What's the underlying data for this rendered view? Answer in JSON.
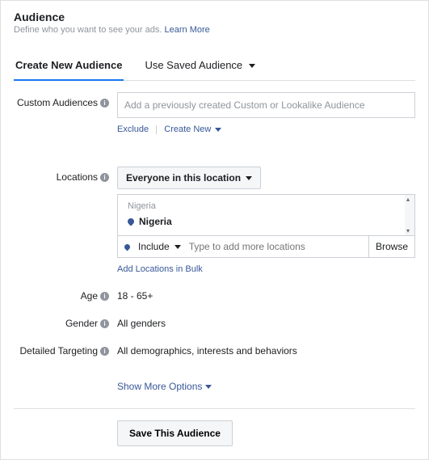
{
  "header": {
    "title": "Audience",
    "subtitle": "Define who you want to see your ads.",
    "learn_more": "Learn More"
  },
  "tabs": {
    "create": "Create New Audience",
    "saved": "Use Saved Audience"
  },
  "labels": {
    "custom": "Custom Audiences",
    "locations": "Locations",
    "age": "Age",
    "gender": "Gender",
    "detailed": "Detailed Targeting"
  },
  "custom": {
    "placeholder": "Add a previously created Custom or Lookalike Audience",
    "exclude": "Exclude",
    "create_new": "Create New"
  },
  "locations": {
    "scope": "Everyone in this location",
    "group_label": "Nigeria",
    "selected": "Nigeria",
    "include": "Include",
    "placeholder": "Type to add more locations",
    "browse": "Browse",
    "bulk": "Add Locations in Bulk"
  },
  "age": {
    "value": "18 - 65+"
  },
  "gender": {
    "value": "All genders"
  },
  "detailed": {
    "value": "All demographics, interests and behaviors"
  },
  "show_more": "Show More Options",
  "save": "Save This Audience"
}
